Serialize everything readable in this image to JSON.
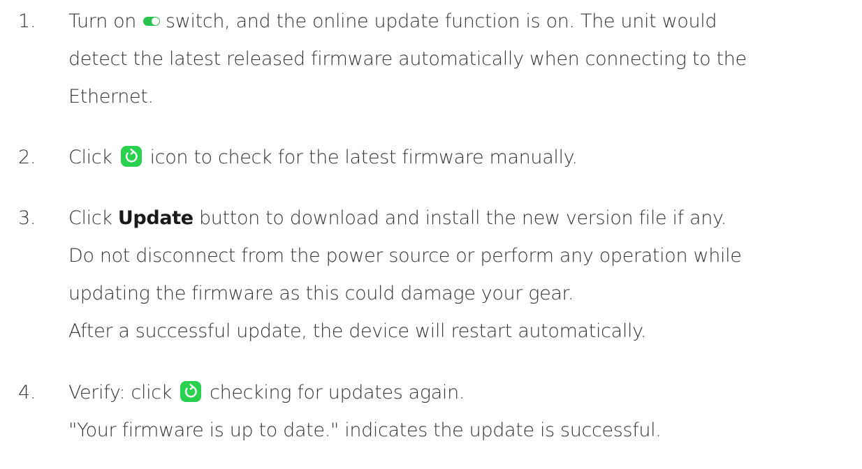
{
  "steps": [
    {
      "number": "1.",
      "line1_before": "Turn on",
      "toggle_icon": "toggle-switch-on-icon",
      "line1_after": "switch, and the online update function is on. The unit would",
      "line2": "detect the latest released firmware automatically when connecting to the",
      "line3": "Ethernet."
    },
    {
      "number": "2.",
      "line1_before": "Click",
      "refresh_icon": "refresh-icon",
      "line1_after": "icon to check for the latest firmware manually."
    },
    {
      "number": "3.",
      "line1_before": "Click",
      "bold": "Update",
      "line1_after": "button to download and install the new version file if any.",
      "line2": "Do not disconnect from the power source or perform any operation while",
      "line3": "updating the firmware as this could damage your gear.",
      "line4": "After a successful update, the device will restart automatically."
    },
    {
      "number": "4.",
      "line1_before": "Verify: click",
      "refresh_icon": "refresh-icon",
      "line1_after": "checking for updates again.",
      "line2": "\"Your firmware is up to date.\" indicates the update is successful."
    }
  ],
  "colors": {
    "text": "#333333",
    "accent_green": "#2ad14f"
  }
}
